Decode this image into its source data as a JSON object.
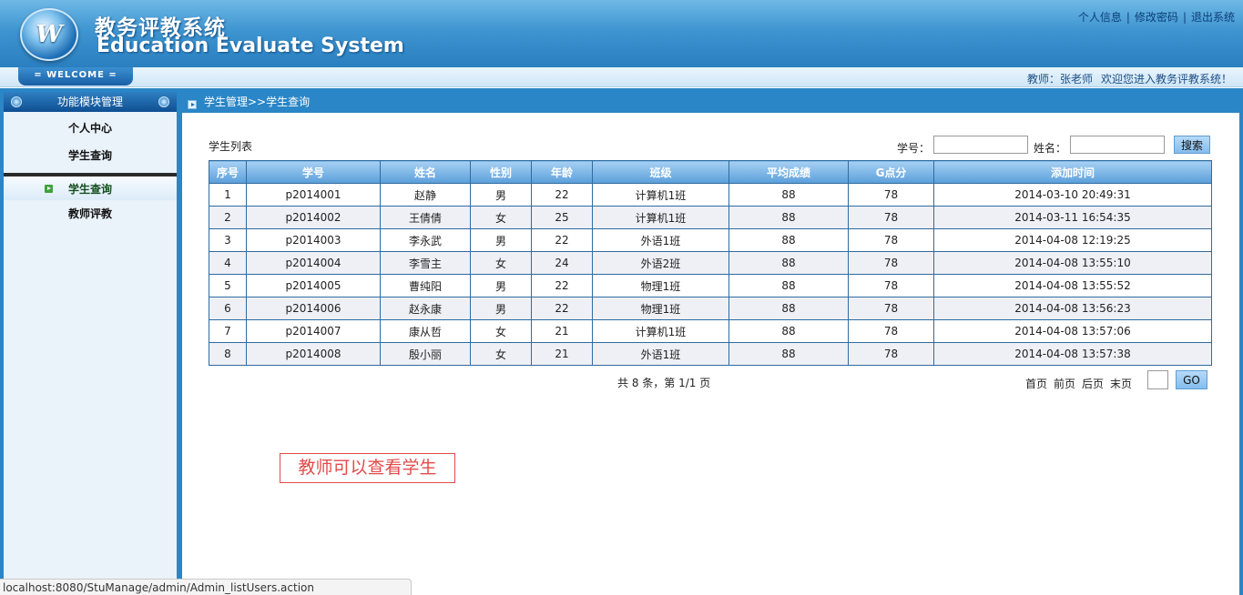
{
  "header": {
    "logo_letter": "W",
    "title_cn": "教务评教系统",
    "title_en": "Education Evaluate System",
    "links": {
      "profile": "个人信息",
      "change_password": "修改密码",
      "logout": "退出系统"
    },
    "separator": "|"
  },
  "welcome_bar": {
    "tab": "= WELCOME =",
    "user": "教师：张老师",
    "greeting": "欢迎您进入教务评教系统！"
  },
  "sidebar": {
    "heading": "功能模块管理",
    "items": [
      {
        "label": "个人中心"
      },
      {
        "label": "学生查询"
      },
      {
        "label": "学生查询"
      },
      {
        "label": "教师评教"
      }
    ]
  },
  "breadcrumb": "学生管理>>学生查询",
  "list": {
    "title": "学生列表",
    "search": {
      "id_label": "学号：",
      "name_label": "姓名：",
      "id_value": "",
      "name_value": "",
      "button": "搜索"
    },
    "columns": [
      "序号",
      "学号",
      "姓名",
      "性别",
      "年龄",
      "班级",
      "平均成绩",
      "G点分",
      "添加时间"
    ],
    "rows": [
      [
        "1",
        "p2014001",
        "赵静",
        "男",
        "22",
        "计算机1班",
        "88",
        "78",
        "2014-03-10 20:49:31"
      ],
      [
        "2",
        "p2014002",
        "王倩倩",
        "女",
        "25",
        "计算机1班",
        "88",
        "78",
        "2014-03-11 16:54:35"
      ],
      [
        "3",
        "p2014003",
        "李永武",
        "男",
        "22",
        "外语1班",
        "88",
        "78",
        "2014-04-08 12:19:25"
      ],
      [
        "4",
        "p2014004",
        "李雪主",
        "女",
        "24",
        "外语2班",
        "88",
        "78",
        "2014-04-08 13:55:10"
      ],
      [
        "5",
        "p2014005",
        "曹纯阳",
        "男",
        "22",
        "物理1班",
        "88",
        "78",
        "2014-04-08 13:55:52"
      ],
      [
        "6",
        "p2014006",
        "赵永康",
        "男",
        "22",
        "物理1班",
        "88",
        "78",
        "2014-04-08 13:56:23"
      ],
      [
        "7",
        "p2014007",
        "康从哲",
        "女",
        "21",
        "计算机1班",
        "88",
        "78",
        "2014-04-08 13:57:06"
      ],
      [
        "8",
        "p2014008",
        "殷小丽",
        "女",
        "21",
        "外语1班",
        "88",
        "78",
        "2014-04-08 13:57:38"
      ]
    ]
  },
  "pager": {
    "info": "共 8 条，第 1/1 页",
    "first": "首页",
    "prev": "前页",
    "next": "后页",
    "last": "末页",
    "page_value": "",
    "go": "GO"
  },
  "note": "教师可以查看学生",
  "status_url": "localhost:8080/StuManage/admin/Admin_listUsers.action",
  "colors": {
    "header_blue": "#3e95d0",
    "frame_blue": "#2a86c6",
    "note_red": "#e24b4b"
  }
}
